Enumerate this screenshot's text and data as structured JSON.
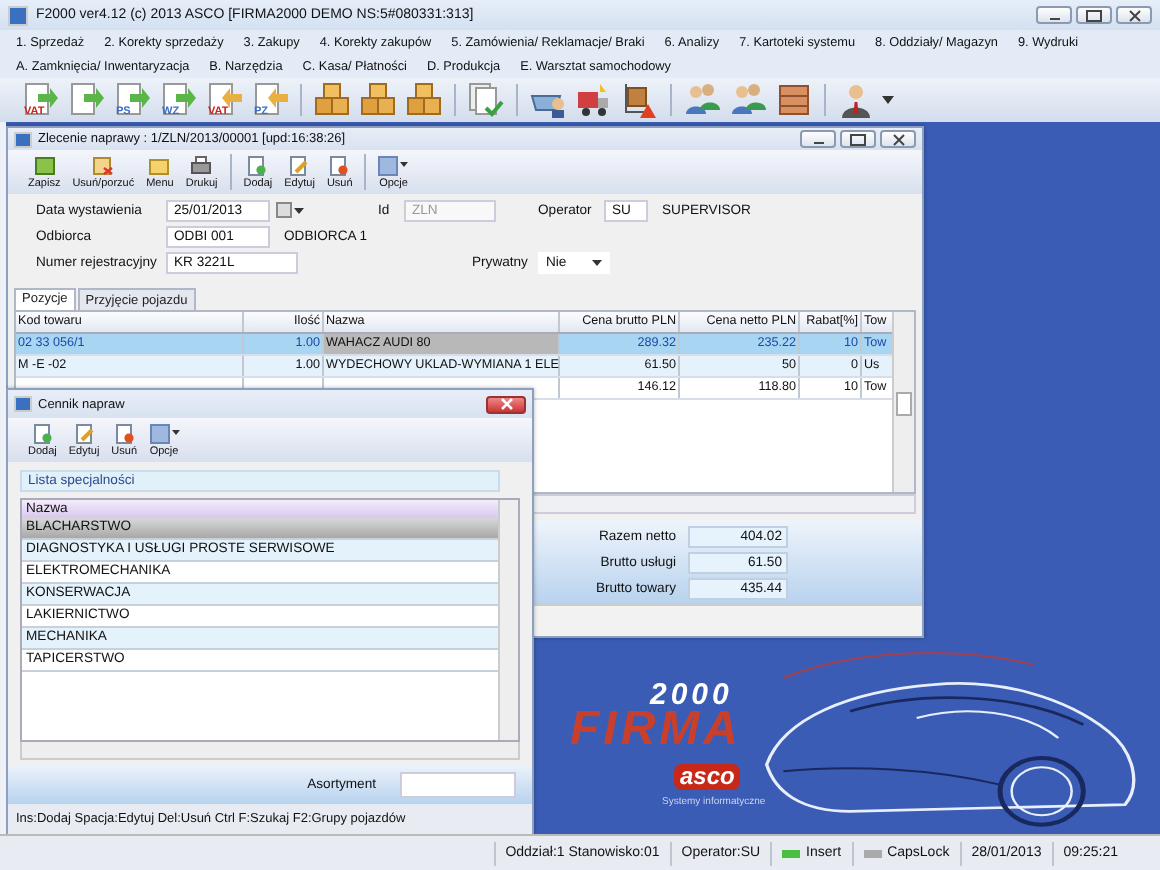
{
  "app_window": {
    "title": "F2000  ver4.12 (c) 2013 ASCO  [FIRMA2000 DEMO NS:5#080331:313]"
  },
  "menu_rows": [
    {
      "items": [
        "1. Sprzedaż",
        "2. Korekty sprzedaży",
        "3. Zakupy",
        "4. Korekty zakupów",
        "5. Zamówienia/ Reklamacje/ Braki",
        "6. Analizy",
        "7. Kartoteki systemu",
        "8. Oddziały/ Magazyn",
        "9. Wydruki"
      ]
    },
    {
      "items": [
        "A. Zamknięcia/ Inwentaryzacja",
        "B. Narzędzia",
        "C. Kasa/ Płatności",
        "D. Produkcja",
        "E. Warsztat samochodowy"
      ]
    }
  ],
  "main_toolbar": [
    {
      "items": [
        {
          "kind": "doc-out",
          "tag": "VAT"
        },
        {
          "kind": "doc-out"
        },
        {
          "kind": "doc-out",
          "tag": "PS"
        },
        {
          "kind": "doc-out",
          "tag": "WZ"
        },
        {
          "kind": "doc-in",
          "tag": "VAT"
        },
        {
          "kind": "doc-in",
          "tag": "PZ"
        }
      ]
    },
    {
      "items": [
        {
          "kind": "boxes"
        },
        {
          "kind": "boxes"
        },
        {
          "kind": "boxes"
        }
      ]
    },
    {
      "items": [
        {
          "kind": "doc-check"
        }
      ]
    },
    {
      "items": [
        {
          "kind": "basket"
        },
        {
          "kind": "truck"
        },
        {
          "kind": "cart"
        }
      ]
    },
    {
      "items": [
        {
          "kind": "people"
        },
        {
          "kind": "people"
        },
        {
          "kind": "cabinet"
        }
      ]
    },
    {
      "items": [
        {
          "kind": "user"
        }
      ]
    }
  ],
  "repair_order": {
    "title": "Zlecenie naprawy : 1/ZLN/2013/00001 [upd:16:38:26]",
    "toolbar_groups": [
      {
        "items": [
          {
            "label": "Zapisz",
            "kind": "save"
          },
          {
            "label": "Usuń/porzuć",
            "kind": "discard"
          },
          {
            "label": "Menu",
            "kind": "menu"
          },
          {
            "label": "Drukuj",
            "kind": "print"
          }
        ]
      },
      {
        "items": [
          {
            "label": "Dodaj",
            "kind": "add"
          },
          {
            "label": "Edytuj",
            "kind": "edit"
          },
          {
            "label": "Usuń",
            "kind": "delete"
          }
        ]
      },
      {
        "items": [
          {
            "label": "Opcje",
            "kind": "options"
          }
        ]
      }
    ],
    "issue_date": {
      "label": "Data wystawienia",
      "value": "25/01/2013"
    },
    "id": {
      "label": "Id",
      "value": "ZLN",
      "disabled": true
    },
    "operator": {
      "label": "Operator",
      "code": "SU",
      "name": "SUPERVISOR"
    },
    "recipient": {
      "label": "Odbiorca",
      "code": "ODBI 001",
      "name": "ODBIORCA 1"
    },
    "registration": {
      "label": "Numer rejestracyjny",
      "value": "KR 3221L"
    },
    "private": {
      "label": "Prywatny",
      "value": "Nie"
    },
    "tabs": [
      {
        "label": "Pozycje",
        "selected": true
      },
      {
        "label": "Przyjęcie pojazdu",
        "selected": false
      }
    ],
    "table": {
      "columns": [
        "Kod towaru",
        "Ilość",
        "Nazwa",
        "Cena brutto PLN",
        "Cena netto PLN",
        "Rabat[%]",
        "Tow"
      ],
      "rows": [
        {
          "cells": [
            "02 33 056/1",
            "1.00",
            "WAHACZ AUDI 80",
            "289.32",
            "235.22",
            "10",
            "Tow"
          ],
          "selected": true
        },
        {
          "cells": [
            "M -E -02",
            "1.00",
            "WYDECHOWY UKLAD-WYMIANA 1 ELE",
            "61.50",
            "50",
            "0",
            "Us"
          ],
          "selected": false
        },
        {
          "cells": [
            "",
            "",
            "",
            "146.12",
            "118.80",
            "10",
            "Tow"
          ],
          "selected": false
        }
      ]
    },
    "totals": [
      {
        "label": "Razem netto",
        "value": "404.02"
      },
      {
        "label": "Brutto usługi",
        "value": "61.50"
      },
      {
        "label": "Brutto towary",
        "value": "435.44"
      }
    ]
  },
  "repair_price_list": {
    "title": "Cennik napraw",
    "toolbar": [
      {
        "label": "Dodaj",
        "kind": "add"
      },
      {
        "label": "Edytuj",
        "kind": "edit"
      },
      {
        "label": "Usuń",
        "kind": "delete"
      },
      {
        "label": "Opcje",
        "kind": "options"
      }
    ],
    "list_title": "Lista specjalności",
    "column": "Nazwa",
    "rows": [
      {
        "name": "BLACHARSTWO",
        "selected": true
      },
      {
        "name": "DIAGNOSTYKA I USŁUGI PROSTE SERWISOWE",
        "selected": false
      },
      {
        "name": "ELEKTROMECHANIKA",
        "selected": false
      },
      {
        "name": "KONSERWACJA",
        "selected": false
      },
      {
        "name": "LAKIERNICTWO",
        "selected": false
      },
      {
        "name": "MECHANIKA",
        "selected": false
      },
      {
        "name": "TAPICERSTWO",
        "selected": false
      }
    ],
    "assortment": {
      "label": "Asortyment"
    },
    "shortcuts": "Ins:Dodaj  Spacja:Edytuj  Del:Usuń  Ctrl F:Szukaj  F2:Grupy pojazdów"
  },
  "desktop_logo": {
    "edition": "2000",
    "product": "FIRMA",
    "brand": "asco",
    "tagline": "Systemy informatyczne"
  },
  "status_bar": {
    "branch": "Oddział:1 Stanowisko:01",
    "operator": "Operator:SU",
    "indicators": [
      {
        "label": "Insert",
        "on": true
      },
      {
        "label": "CapsLock",
        "on": false
      }
    ],
    "date": "28/01/2013",
    "time": "09:25:21"
  }
}
